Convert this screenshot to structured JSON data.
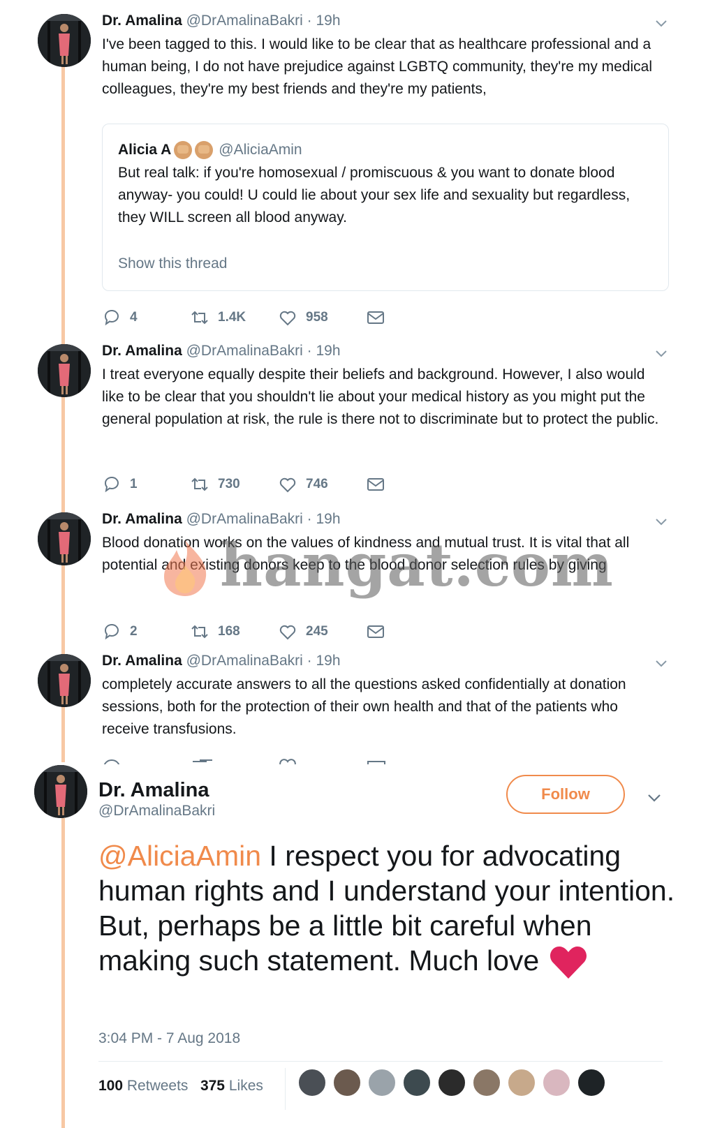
{
  "tweets": [
    {
      "name": "Dr. Amalina",
      "handle": "@DrAmalinaBakri",
      "sep": "·",
      "time": "19h",
      "text": "I've been tagged to this. I would like to be clear that as healthcare professional and a human being, I do not have prejudice against LGBTQ community, they're my medical colleagues, they're my best friends and they're my patients,",
      "quote": {
        "name": "Alicia A",
        "handle": "@AliciaAmin",
        "text": "But real talk: if you're homosexual / promiscuous & you want to donate blood anyway- you could! U could lie about your sex life and sexuality but regardless, they WILL screen all blood anyway.",
        "show_thread": "Show this thread"
      },
      "replies": "4",
      "retweets": "1.4K",
      "likes": "958"
    },
    {
      "name": "Dr. Amalina",
      "handle": "@DrAmalinaBakri",
      "sep": "·",
      "time": "19h",
      "text": "I treat everyone equally despite their beliefs and background. However, I also would like to be clear that you shouldn't lie about your medical history as you might put the general population at risk, the rule is there not to discriminate but to protect the public.",
      "replies": "1",
      "retweets": "730",
      "likes": "746"
    },
    {
      "name": "Dr. Amalina",
      "handle": "@DrAmalinaBakri",
      "sep": "·",
      "time": "19h",
      "text": "Blood donation works on the values of kindness and mutual trust. It is vital that all potential and existing donors keep to the blood donor selection rules by giving",
      "replies": "2",
      "retweets": "168",
      "likes": "245"
    },
    {
      "name": "Dr. Amalina",
      "handle": "@DrAmalinaBakri",
      "sep": "·",
      "time": "19h",
      "text": "completely accurate answers to all the questions asked confidentially at donation sessions, both for the protection of their own health and that of the patients who receive transfusions."
    }
  ],
  "main_tweet": {
    "name": "Dr. Amalina",
    "handle": "@DrAmalinaBakri",
    "follow_label": "Follow",
    "mention": "@AliciaAmin",
    "text": " I respect you for advocating human rights and I understand your intention. But, perhaps be a little bit careful when making such statement. Much love",
    "timestamp": "3:04 PM - 7 Aug 2018",
    "retweets_count": "100",
    "retweets_label": "Retweets",
    "likes_count": "375",
    "likes_label": "Likes"
  },
  "watermark": "hangat.com",
  "icons": [
    "reply-icon",
    "retweet-icon",
    "like-icon",
    "dm-icon",
    "chevron-down-icon",
    "heart-emoji-icon",
    "fist-emoji-icon"
  ],
  "colors": {
    "accent": "#f08a4b",
    "thread_line": "#f7c8a4",
    "muted": "#657786",
    "heart": "#e0245e"
  }
}
